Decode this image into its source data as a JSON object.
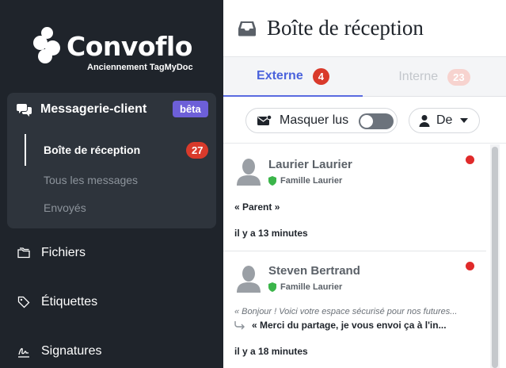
{
  "sidebar": {
    "logo_text": "Convoflo",
    "logo_sub": "Anciennement TagMyDoc",
    "messaging": {
      "label": "Messagerie-client",
      "badge": "bêta",
      "items": [
        {
          "label": "Boîte de réception",
          "count": "27",
          "active": true
        },
        {
          "label": "Tous les messages"
        },
        {
          "label": "Envoyés"
        }
      ]
    },
    "nav": [
      {
        "label": "Fichiers",
        "icon": "folder-icon"
      },
      {
        "label": "Étiquettes",
        "icon": "tag-icon"
      },
      {
        "label": "Signatures",
        "icon": "signature-icon"
      }
    ]
  },
  "main": {
    "title": "Boîte de réception",
    "tabs": [
      {
        "label": "Externe",
        "count": "4",
        "active": true
      },
      {
        "label": "Interne",
        "count": "23"
      }
    ],
    "toolbar": {
      "mask_read_label": "Masquer lus",
      "mask_read_on": false,
      "from_label": "De"
    },
    "messages": [
      {
        "sender": "Laurier Laurier",
        "group": "Famille Laurier",
        "preview": "« Parent »",
        "time": "il y a 13 minutes",
        "unread": true
      },
      {
        "sender": "Steven Bertrand",
        "group": "Famille Laurier",
        "quote": "« Bonjour ! Voici votre espace sécurisé pour nos futures...",
        "reply": "« Merci du partage, je vous envoi ça à l'in...",
        "time": "il y a 18 minutes",
        "unread": true
      }
    ]
  },
  "colors": {
    "sidebar_bg": "#1f242b",
    "accent": "#4b63dc",
    "badge_red": "#d93a2b",
    "beta_purple": "#6d5fd8"
  }
}
